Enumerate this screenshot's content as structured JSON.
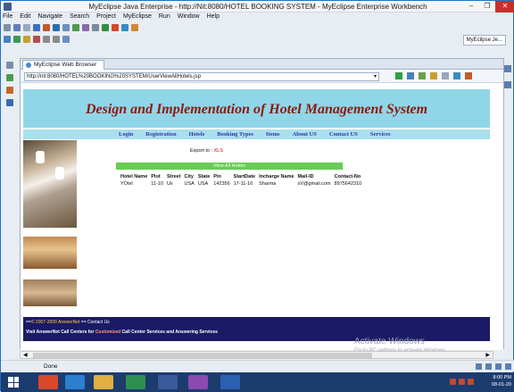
{
  "window": {
    "title": "MyEclipse Java Enterprise - http://Nit:8080/HOTEL BOOKING SYSTEM - MyEclipse Enterprise Workbench",
    "minimize": "–",
    "maximize": "❐",
    "close": "✕"
  },
  "menu": [
    "File",
    "Edit",
    "Navigate",
    "Search",
    "Project",
    "MyEclipse",
    "Run",
    "Window",
    "Help"
  ],
  "perspective": "MyEclipse Je...",
  "editor_tab": "MyEclipse Web Browser",
  "browser": {
    "url": "http://nit:8080/HOTEL%20BOOKING%20SYSTEM/UserViewAllHotels.jsp"
  },
  "site": {
    "title": "Design and Implementation of Hotel Management System",
    "nav": [
      "Login",
      "Registration",
      "Hotels",
      "Booking Types",
      "Items",
      "About US",
      "Contact US",
      "Services"
    ],
    "export_label": "Export to :",
    "export_link": "XLS",
    "view_all_label": "View All Hotels",
    "table": {
      "headers": [
        "Hotel Name",
        "Plot",
        "Street",
        "City",
        "State",
        "Pin",
        "StartDate",
        "Incharge Name",
        "Mail-ID",
        "Contact-No"
      ],
      "rows": [
        [
          "YOtel",
          "11-10",
          "Us",
          "USA",
          "USA",
          "142356",
          "17-11-16",
          "Sharma",
          "sV@gmail.com",
          "8975642310"
        ]
      ]
    },
    "footer": {
      "line1_prefix": "==",
      "line1_copyright": "© 2007-2009 AnswerNet",
      "line1_suffix": "== Contact Us",
      "line2_brand": "Visit AnswerNet",
      "line2_text": "Call Centers for",
      "line2_highlight": "Customized",
      "line2_text2": "Call Center Services and Answering Services"
    }
  },
  "watermark": {
    "line1": "Activate Windows",
    "line2": "Go to PC settings to activate Windows."
  },
  "status": "Done",
  "clock": {
    "time": "8:00 PM",
    "date": "08-01-20"
  },
  "colors": {
    "banner": "#8fd6e8",
    "nav_text": "#3333aa",
    "title_text": "#8a1a10",
    "view_all": "#66cc55",
    "footer": "#1a1a66",
    "taskbar": "#1c3c6e"
  }
}
